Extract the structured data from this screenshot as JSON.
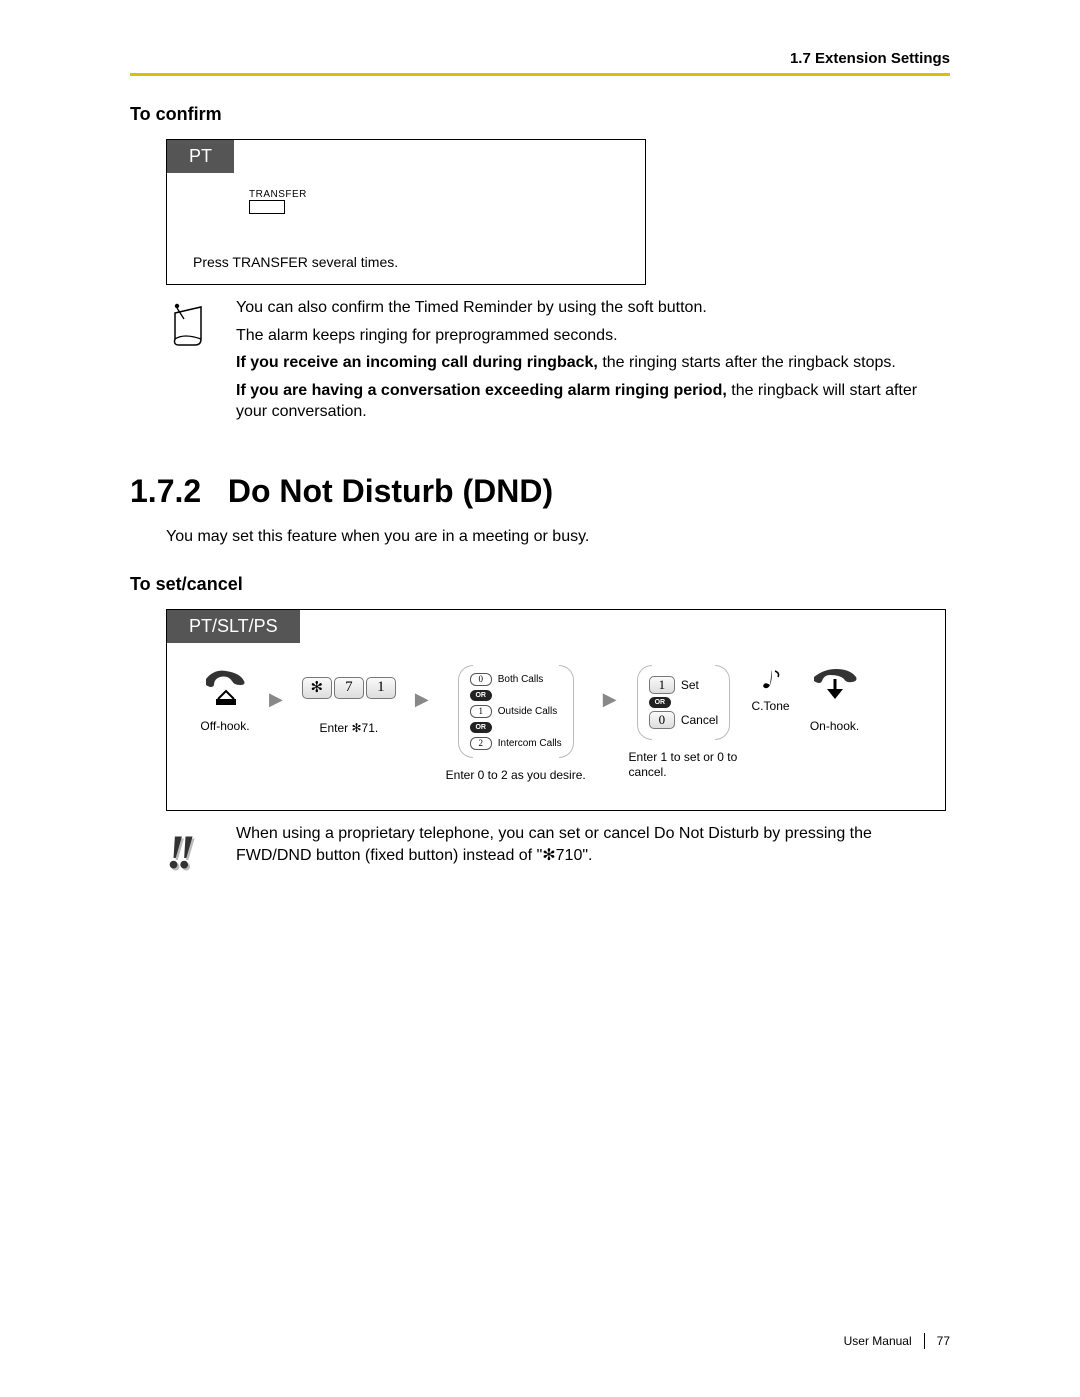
{
  "header": {
    "section_ref": "1.7 Extension Settings"
  },
  "confirm": {
    "heading": "To confirm",
    "tab": "PT",
    "button_label": "TRANSFER",
    "caption": "Press TRANSFER several times."
  },
  "notes_confirm": {
    "line1": "You can also confirm the Timed Reminder by using the soft button.",
    "line2": "The alarm keeps ringing for preprogrammed seconds.",
    "line3a": "If you receive an incoming call during ringback,",
    "line3b": " the ringing starts after the ringback stops.",
    "line4a": "If you are having a conversation exceeding alarm ringing period,",
    "line4b": " the ringback will start after your conversation."
  },
  "dnd": {
    "number": "1.7.2",
    "title": "Do Not Disturb (DND)",
    "intro": "You may set this feature when you are in a meeting or busy.",
    "sub": "To set/cancel",
    "tab": "PT/SLT/PS"
  },
  "steps": {
    "s1": {
      "caption": "Off-hook."
    },
    "s2": {
      "k1": "✻",
      "k2": "7",
      "k3": "1",
      "caption": "Enter ✻71."
    },
    "s3": {
      "o0": "0",
      "o0l": "Both Calls",
      "or": "OR",
      "o1": "1",
      "o1l": "Outside Calls",
      "o2": "2",
      "o2l": "Intercom Calls",
      "caption": "Enter 0 to 2 as you desire."
    },
    "s4": {
      "k1": "1",
      "k1l": "Set",
      "or": "OR",
      "k0": "0",
      "k0l": "Cancel",
      "caption": "Enter 1 to set or 0 to cancel."
    },
    "s5": {
      "label": "C.Tone"
    },
    "s6": {
      "caption": "On-hook."
    }
  },
  "exclaim_note": "When using a proprietary telephone, you can set or cancel Do Not Disturb by pressing the FWD/DND button (fixed button) instead of \"✻710\".",
  "footer": {
    "doc": "User Manual",
    "page": "77"
  }
}
